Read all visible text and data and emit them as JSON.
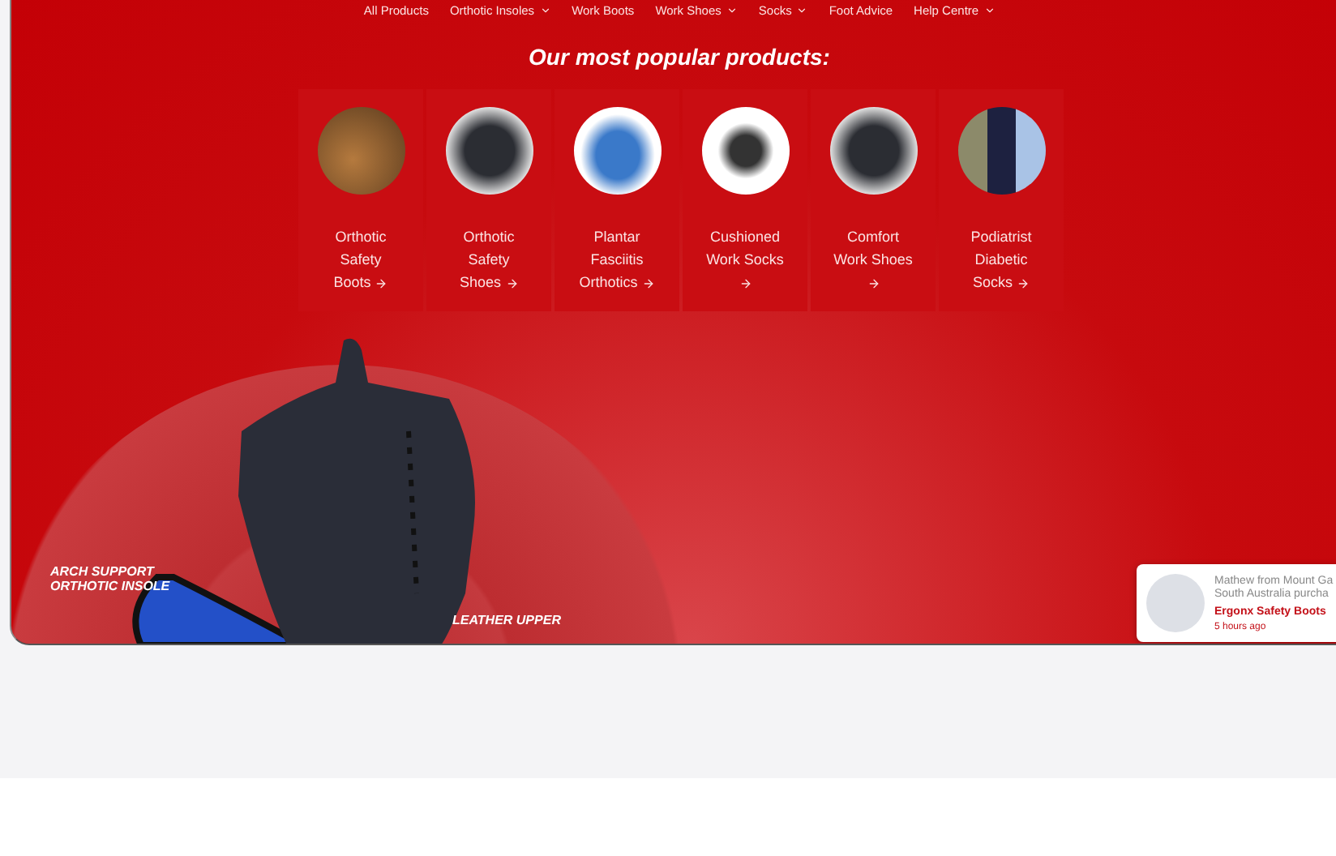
{
  "nav": [
    {
      "label": "All Products",
      "has_menu": false
    },
    {
      "label": "Orthotic Insoles",
      "has_menu": true
    },
    {
      "label": "Work Boots",
      "has_menu": false
    },
    {
      "label": "Work Shoes",
      "has_menu": true
    },
    {
      "label": "Socks",
      "has_menu": true
    },
    {
      "label": "Foot Advice",
      "has_menu": false
    },
    {
      "label": "Help Centre",
      "has_menu": true
    }
  ],
  "popular": {
    "heading": "Our most popular products:",
    "products": [
      {
        "label": "Orthotic Safety Boots",
        "kind": "boots"
      },
      {
        "label": "Orthotic Safety Shoes",
        "kind": "shoe"
      },
      {
        "label": "Plantar Fasciitis Orthotics",
        "kind": "insole"
      },
      {
        "label": "Cushioned Work Socks",
        "kind": "sock"
      },
      {
        "label": "Comfort Work Shoes",
        "kind": "shoe"
      },
      {
        "label": "Podiatrist Diabetic Socks",
        "kind": "socks"
      }
    ]
  },
  "hero": {
    "callouts": [
      "ARCH SUPPORT ORTHOTIC INSOLE",
      "LEATHER UPPER"
    ]
  },
  "toast": {
    "lines": [
      "Mathew from Mount Ga",
      "South Australia purcha"
    ],
    "product": "Ergonx Safety Boots",
    "time": "5 hours ago"
  }
}
